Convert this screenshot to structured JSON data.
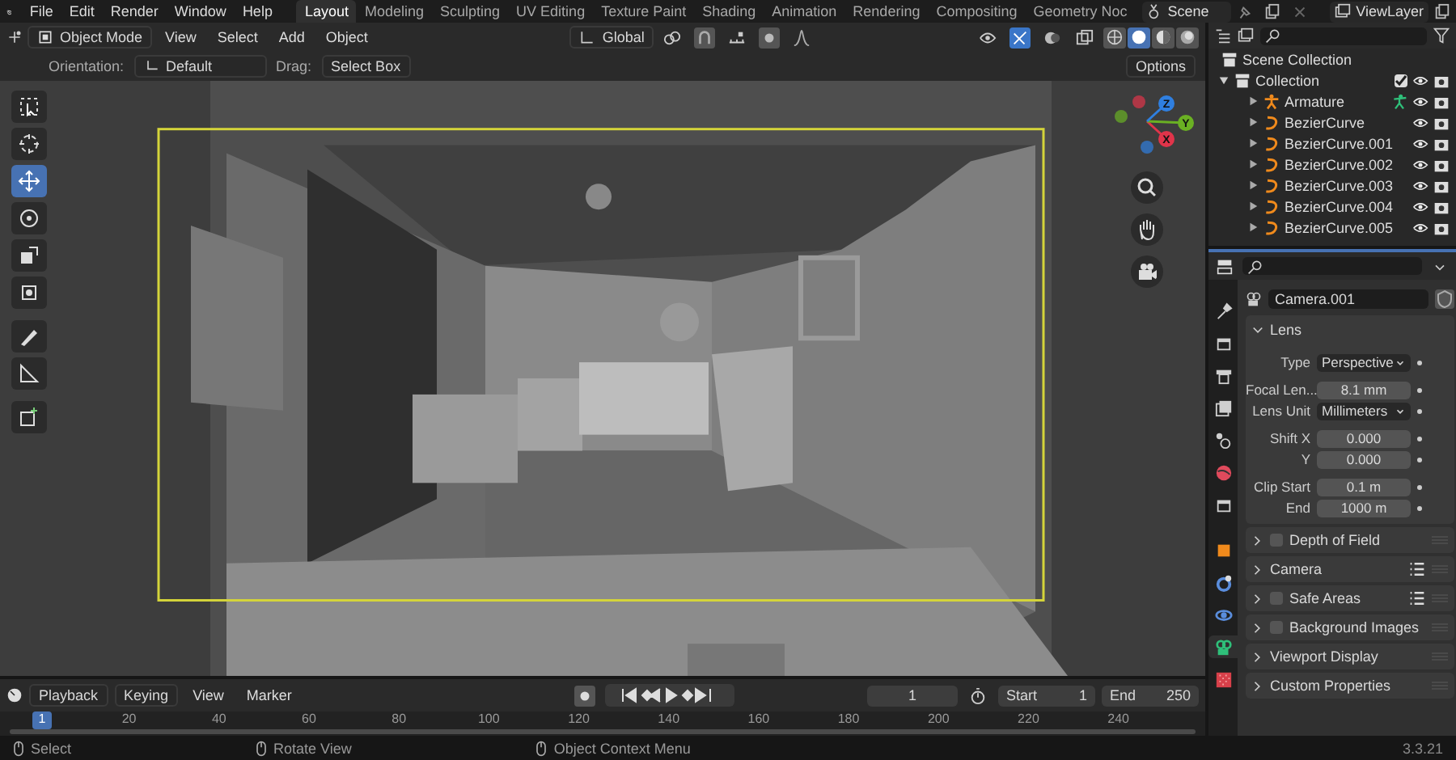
{
  "menu": [
    "File",
    "Edit",
    "Render",
    "Window",
    "Help"
  ],
  "workspaces": [
    {
      "label": "Layout",
      "selected": true
    },
    {
      "label": "Modeling",
      "selected": false
    },
    {
      "label": "Sculpting",
      "selected": false
    },
    {
      "label": "UV Editing",
      "selected": false
    },
    {
      "label": "Texture Paint",
      "selected": false
    },
    {
      "label": "Shading",
      "selected": false
    },
    {
      "label": "Animation",
      "selected": false
    },
    {
      "label": "Rendering",
      "selected": false
    },
    {
      "label": "Compositing",
      "selected": false
    },
    {
      "label": "Geometry Noc",
      "selected": false
    }
  ],
  "scene": "Scene",
  "view_layer": "ViewLayer",
  "viewport": {
    "mode": "Object Mode",
    "menus": [
      "View",
      "Select",
      "Add",
      "Object"
    ],
    "transform_orientation": "Global",
    "shading_modes": [
      {
        "kind": "wireframe",
        "selected": false
      },
      {
        "kind": "solid",
        "selected": true
      },
      {
        "kind": "material",
        "selected": false
      },
      {
        "kind": "rendered",
        "selected": false
      }
    ],
    "orientation_label": "Orientation:",
    "orientation": "Default",
    "drag_label": "Drag:",
    "drag": "Select Box",
    "options": "Options",
    "tools": [
      {
        "kind": "select",
        "selected": false
      },
      {
        "kind": "cursor",
        "selected": false
      },
      {
        "kind": "move",
        "selected": true
      },
      {
        "kind": "rotate",
        "selected": false
      },
      {
        "kind": "scale",
        "selected": false
      },
      {
        "kind": "transform",
        "selected": false
      },
      {
        "kind": "annotate",
        "selected": false
      },
      {
        "kind": "measure",
        "selected": false
      },
      {
        "kind": "add_cube",
        "selected": false
      }
    ],
    "gizmo_axes": [
      "X",
      "Y",
      "Z"
    ]
  },
  "outliner": {
    "root": "Scene Collection",
    "collection": {
      "label": "Collection",
      "expanded": true,
      "checked": true,
      "children": [
        {
          "label": "Armature",
          "kind": "armature",
          "expanded": false
        },
        {
          "label": "BezierCurve",
          "kind": "curve",
          "expanded": false
        },
        {
          "label": "BezierCurve.001",
          "kind": "curve",
          "expanded": false
        },
        {
          "label": "BezierCurve.002",
          "kind": "curve",
          "expanded": false
        },
        {
          "label": "BezierCurve.003",
          "kind": "curve",
          "expanded": false
        },
        {
          "label": "BezierCurve.004",
          "kind": "curve",
          "expanded": false
        },
        {
          "label": "BezierCurve.005",
          "kind": "curve",
          "expanded": false
        }
      ]
    }
  },
  "properties": {
    "object": "Camera.001",
    "tabs": [
      {
        "kind": "tool",
        "selected": false
      },
      {
        "kind": "render",
        "selected": false
      },
      {
        "kind": "output",
        "selected": false
      },
      {
        "kind": "view_layer",
        "selected": false
      },
      {
        "kind": "scene",
        "selected": false
      },
      {
        "kind": "world",
        "selected": false
      },
      {
        "kind": "collection",
        "selected": false
      },
      {
        "kind": "object",
        "selected": false
      },
      {
        "kind": "constraints",
        "selected": false
      },
      {
        "kind": "physics",
        "selected": false
      },
      {
        "kind": "camera_data",
        "selected": true
      },
      {
        "kind": "texture",
        "selected": false
      }
    ],
    "lens": {
      "title": "Lens",
      "expanded": true,
      "groups": [
        [
          {
            "label": "Type",
            "value": "Perspective",
            "kind": "dropdown"
          }
        ],
        [
          {
            "label": "Focal Len...",
            "value": "8.1 mm",
            "kind": "number"
          },
          {
            "label": "Lens Unit",
            "value": "Millimeters",
            "kind": "dropdown"
          }
        ],
        [
          {
            "label": "Shift X",
            "value": "0.000",
            "kind": "number"
          },
          {
            "label": "Y",
            "value": "0.000",
            "kind": "number"
          }
        ],
        [
          {
            "label": "Clip Start",
            "value": "0.1 m",
            "kind": "number"
          },
          {
            "label": "End",
            "value": "1000 m",
            "kind": "number"
          }
        ]
      ]
    },
    "panels": [
      {
        "label": "Depth of Field",
        "kind": "checkbox",
        "checked": false,
        "presets": false
      },
      {
        "label": "Camera",
        "kind": "plain",
        "presets": true
      },
      {
        "label": "Safe Areas",
        "kind": "checkbox",
        "checked": false,
        "presets": true
      },
      {
        "label": "Background Images",
        "kind": "checkbox",
        "checked": false,
        "presets": false
      },
      {
        "label": "Viewport Display",
        "kind": "plain",
        "presets": false
      },
      {
        "label": "Custom Properties",
        "kind": "plain",
        "presets": false
      }
    ]
  },
  "timeline": {
    "menus": [
      "Playback",
      "Keying",
      "View",
      "Marker"
    ],
    "current_frame": "1",
    "start_label": "Start",
    "start": "1",
    "end_label": "End",
    "end": "250",
    "ruler": [
      "1",
      "20",
      "40",
      "60",
      "80",
      "100",
      "120",
      "140",
      "160",
      "180",
      "200",
      "220",
      "240"
    ]
  },
  "status_bar": {
    "hints": [
      {
        "label": "Select"
      },
      {
        "label": "Rotate View"
      },
      {
        "label": "Object Context Menu"
      }
    ],
    "version": "3.3.21"
  }
}
